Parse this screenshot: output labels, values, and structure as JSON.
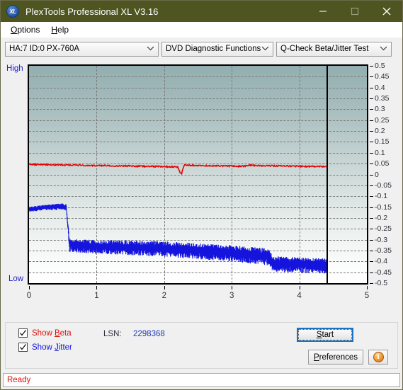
{
  "window": {
    "title": "PlexTools Professional XL V3.16",
    "icon": "xl-logo-icon",
    "icon_text": "XL",
    "titlebar_color": "#4f5520",
    "minimize": "minimize-icon",
    "maximize": "maximize-icon",
    "close": "close-icon"
  },
  "menubar": {
    "items": [
      {
        "label": "Options",
        "accel": "O"
      },
      {
        "label": "Help",
        "accel": "H"
      }
    ]
  },
  "toolbar": {
    "drive_select": "HA:7 ID:0  PX-760A",
    "function_select": "DVD Diagnostic Functions",
    "test_select": "Q-Check Beta/Jitter Test",
    "chevron": "chevron-down-icon"
  },
  "chart_data": {
    "type": "line",
    "title": "Q-Check Beta/Jitter Test",
    "xlabel": "",
    "ylabel": "",
    "xlim": [
      0,
      5
    ],
    "ylim": [
      -0.5,
      0.5
    ],
    "grid": true,
    "x_ticks": [
      0,
      1,
      2,
      3,
      4,
      5
    ],
    "y_ticks": [
      0.5,
      0.45,
      0.4,
      0.35,
      0.3,
      0.25,
      0.2,
      0.15,
      0.1,
      0.05,
      0,
      -0.05,
      -0.1,
      -0.15,
      -0.2,
      -0.25,
      -0.3,
      -0.35,
      -0.4,
      -0.45,
      -0.5
    ],
    "axis_edge_labels": {
      "top": "High",
      "bottom": "Low"
    },
    "data_end_x": 4.4,
    "series": [
      {
        "name": "Beta",
        "color": "#e60000",
        "x": [
          0.0,
          0.1,
          0.2,
          0.3,
          0.4,
          0.5,
          0.6,
          0.7,
          0.8,
          0.9,
          1.0,
          1.1,
          1.2,
          1.3,
          1.4,
          1.5,
          1.6,
          1.7,
          1.8,
          1.9,
          2.0,
          2.1,
          2.2,
          2.25,
          2.3,
          2.4,
          2.5,
          2.6,
          2.7,
          2.8,
          2.9,
          3.0,
          3.1,
          3.2,
          3.25,
          3.3,
          3.4,
          3.5,
          3.6,
          3.7,
          3.8,
          3.9,
          4.0,
          4.1,
          4.2,
          4.3,
          4.4
        ],
        "y": [
          0.047,
          0.046,
          0.045,
          0.045,
          0.044,
          0.044,
          0.043,
          0.043,
          0.042,
          0.042,
          0.041,
          0.041,
          0.04,
          0.04,
          0.039,
          0.039,
          0.038,
          0.038,
          0.037,
          0.037,
          0.036,
          0.036,
          0.035,
          0.0,
          0.043,
          0.042,
          0.041,
          0.041,
          0.04,
          0.04,
          0.039,
          0.039,
          0.038,
          0.038,
          0.043,
          0.042,
          0.041,
          0.04,
          0.04,
          0.039,
          0.039,
          0.038,
          0.038,
          0.037,
          0.037,
          0.036,
          0.036
        ]
      },
      {
        "name": "Jitter",
        "color": "#1414dd",
        "band": true,
        "x": [
          0.0,
          0.1,
          0.2,
          0.3,
          0.4,
          0.5,
          0.55,
          0.6,
          0.8,
          1.0,
          1.2,
          1.4,
          1.6,
          1.8,
          2.0,
          2.2,
          2.4,
          2.6,
          2.8,
          3.0,
          3.2,
          3.4,
          3.55,
          3.6,
          3.8,
          4.0,
          4.2,
          4.4
        ],
        "y": [
          -0.16,
          -0.156,
          -0.152,
          -0.15,
          -0.148,
          -0.147,
          -0.15,
          -0.325,
          -0.328,
          -0.33,
          -0.332,
          -0.334,
          -0.336,
          -0.338,
          -0.34,
          -0.344,
          -0.348,
          -0.352,
          -0.356,
          -0.36,
          -0.366,
          -0.372,
          -0.376,
          -0.408,
          -0.412,
          -0.414,
          -0.416,
          -0.418
        ],
        "half_width": [
          0.01,
          0.01,
          0.01,
          0.011,
          0.012,
          0.013,
          0.013,
          0.026,
          0.026,
          0.027,
          0.027,
          0.028,
          0.028,
          0.029,
          0.029,
          0.03,
          0.03,
          0.031,
          0.031,
          0.032,
          0.032,
          0.033,
          0.033,
          0.03,
          0.03,
          0.03,
          0.03,
          0.029
        ]
      }
    ]
  },
  "controls": {
    "show_beta": {
      "label": "Show Beta",
      "accel": "B",
      "checked": true,
      "color": "#e01010"
    },
    "show_jitter": {
      "label": "Show Jitter",
      "accel": "J",
      "checked": true,
      "color": "#1414dd"
    },
    "lsn_label": "LSN:",
    "lsn_value": "2298368",
    "start_button": "Start",
    "start_accel": "S",
    "preferences_button": "Preferences",
    "preferences_accel": "P",
    "info_button": "info-icon",
    "info_glyph": "i"
  },
  "statusbar": {
    "text": "Ready",
    "color": "#e01010"
  }
}
